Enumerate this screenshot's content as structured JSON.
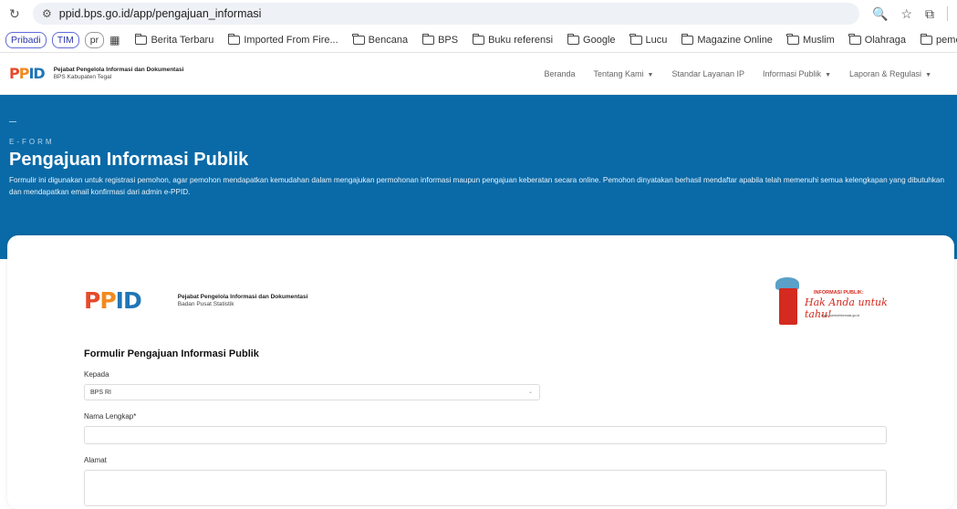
{
  "browser": {
    "url": "ppid.bps.go.id/app/pengajuan_informasi",
    "bookmarks": {
      "chips": [
        "Pribadi",
        "TIM",
        "pr"
      ],
      "items": [
        "Berita Terbaru",
        "Imported From Fire...",
        "Bencana",
        "BPS",
        "Buku referensi",
        "Google",
        "Lucu",
        "Magazine Online",
        "Muslim",
        "Olahraga",
        "pemerintah"
      ],
      "overflow": "»"
    }
  },
  "site": {
    "logo_l1": "Pejabat Pengelola Informasi dan Dokumentasi",
    "logo_l2": "BPS Kabupaten Tegal",
    "menu": [
      "Beranda",
      "Tentang Kami",
      "Standar Layanan IP",
      "Informasi Publik",
      "Laporan & Regulasi"
    ]
  },
  "hero": {
    "eyebrow": "E-FORM",
    "title": "Pengajuan Informasi Publik",
    "description": "Formulir ini digunakan untuk registrasi pemohon, agar pemohon mendapatkan kemudahan dalam mengajukan permohonan informasi maupun pengajuan keberatan secara online. Pemohon dinyatakan berhasil mendaftar apabila telah memenuhi semua kelengkapan yang dibutuhkan dan mendapatkan email konfirmasi dari admin e-PPID."
  },
  "card": {
    "logo_l1": "Pejabat Pengelola Informasi dan Dokumentasi",
    "logo_l2": "Badan Pusat Statistik",
    "badge_t1": "INFORMASI PUBLIK:",
    "badge_t2": "Hak Anda untuk tahu!",
    "badge_t3": "www.komisiinformasi.go.id"
  },
  "form": {
    "title": "Formulir Pengajuan Informasi Publik",
    "kepada_label": "Kepada",
    "kepada_value": "BPS RI",
    "nama_label": "Nama Lengkap*",
    "alamat_label": "Alamat"
  }
}
